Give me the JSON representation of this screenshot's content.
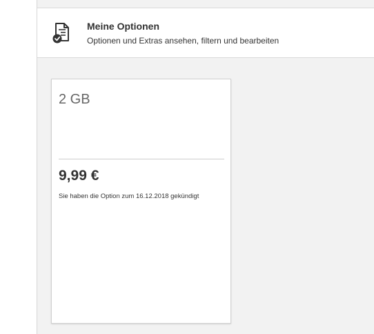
{
  "header": {
    "icon": "document-check-icon",
    "title": "Meine Optionen",
    "subtitle": "Optionen und Extras ansehen, filtern und bearbeiten"
  },
  "option_card": {
    "volume": "2 GB",
    "price": "9,99 €",
    "status": "Sie haben die Option zum 16.12.2018 gekündigt"
  },
  "colors": {
    "background": "#f2f2f2",
    "card": "#ffffff",
    "text": "#333333",
    "muted_text": "#666666",
    "border": "#d9d9d9"
  }
}
